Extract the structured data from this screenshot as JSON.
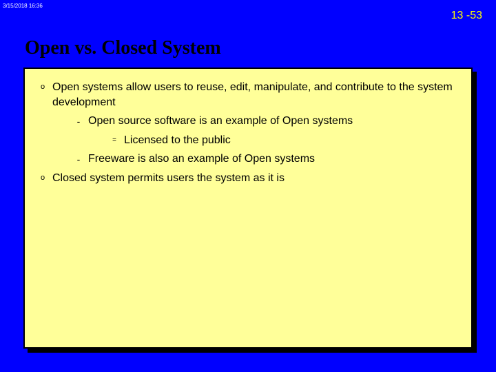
{
  "timestamp": "3/15/2018 16:36",
  "page_number": "13 -53",
  "title": "Open vs. Closed System",
  "bullets": {
    "b1": "Open systems allow users to reuse, edit, manipulate, and contribute to the system development",
    "b1a": "Open source software is an example of Open systems",
    "b1a1": "Licensed to the public",
    "b1b": "Freeware is also an example of Open systems",
    "b2": "Closed system  permits users the system as it is"
  },
  "glyphs": {
    "o": "o",
    "dash": "-",
    "eq": "="
  }
}
